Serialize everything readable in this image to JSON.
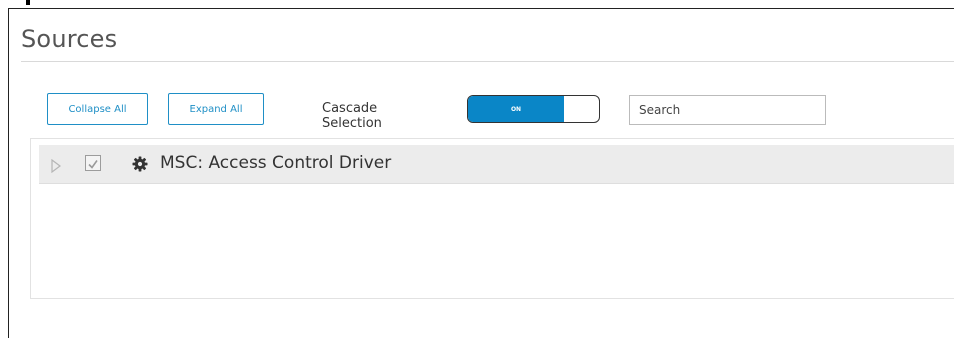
{
  "page": {
    "title": "Sources"
  },
  "toolbar": {
    "collapse_label": "Collapse All",
    "expand_label": "Expand All",
    "cascade_label": "Cascade Selection",
    "cascade_toggle_state": "ON",
    "search_placeholder": "Search",
    "search_value": ""
  },
  "tree": {
    "items": [
      {
        "label": "MSC: Access Control Driver",
        "icon": "gear-icon",
        "checked": true,
        "expanded": false
      }
    ]
  },
  "colors": {
    "accent": "#0a86c7",
    "button_border": "#1f8fc6",
    "row_background": "#ececec"
  }
}
